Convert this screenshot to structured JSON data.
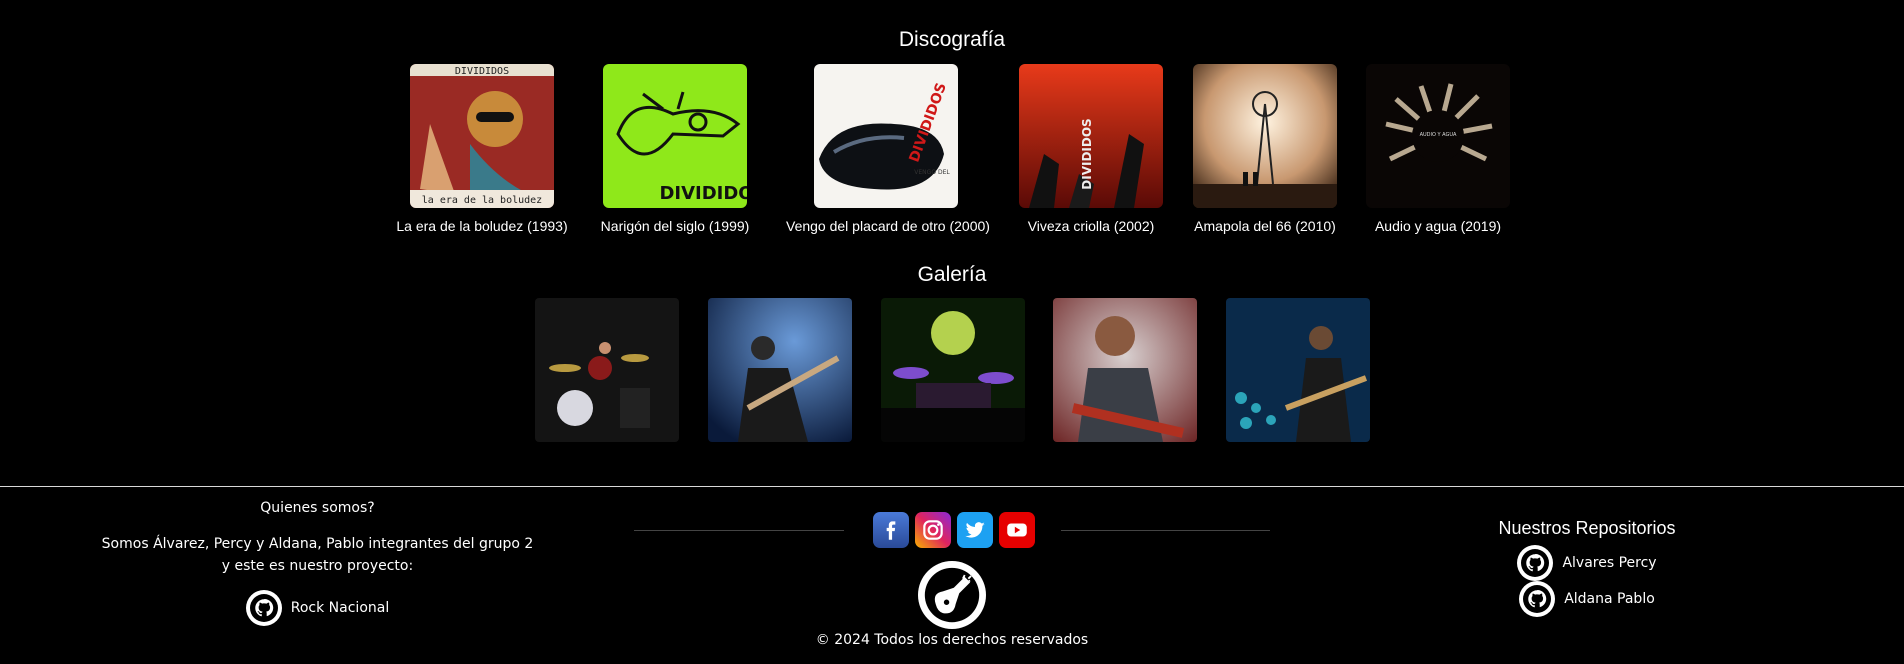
{
  "discography": {
    "title": "Discografía",
    "albums": [
      {
        "caption": "La era de la boludez (1993)"
      },
      {
        "caption": "Narigón del siglo (1999)"
      },
      {
        "caption": "Vengo del placard de otro (2000)"
      },
      {
        "caption": "Viveza criolla (2002)"
      },
      {
        "caption": "Amapola del 66 (2010)"
      },
      {
        "caption": "Audio y agua (2019)"
      }
    ]
  },
  "gallery": {
    "title": "Galería"
  },
  "footer": {
    "about": {
      "heading": "Quienes somos?",
      "line1": "Somos Álvarez, Percy y Aldana, Pablo integrantes del grupo 2",
      "line2": "y este es nuestro proyecto:",
      "project_link": "Rock Nacional"
    },
    "social": [
      "facebook-icon",
      "instagram-icon",
      "twitter-icon",
      "youtube-icon"
    ],
    "copyright": "© 2024 Todos los derechos reservados",
    "repos": {
      "heading": "Nuestros Repositorios",
      "links": [
        "Alvares Percy",
        "Aldana Pablo"
      ]
    }
  },
  "colors": {
    "background": "#000000",
    "facebook": "#3b5998",
    "youtube": "#e60000",
    "twitter": "#1da1f2"
  }
}
